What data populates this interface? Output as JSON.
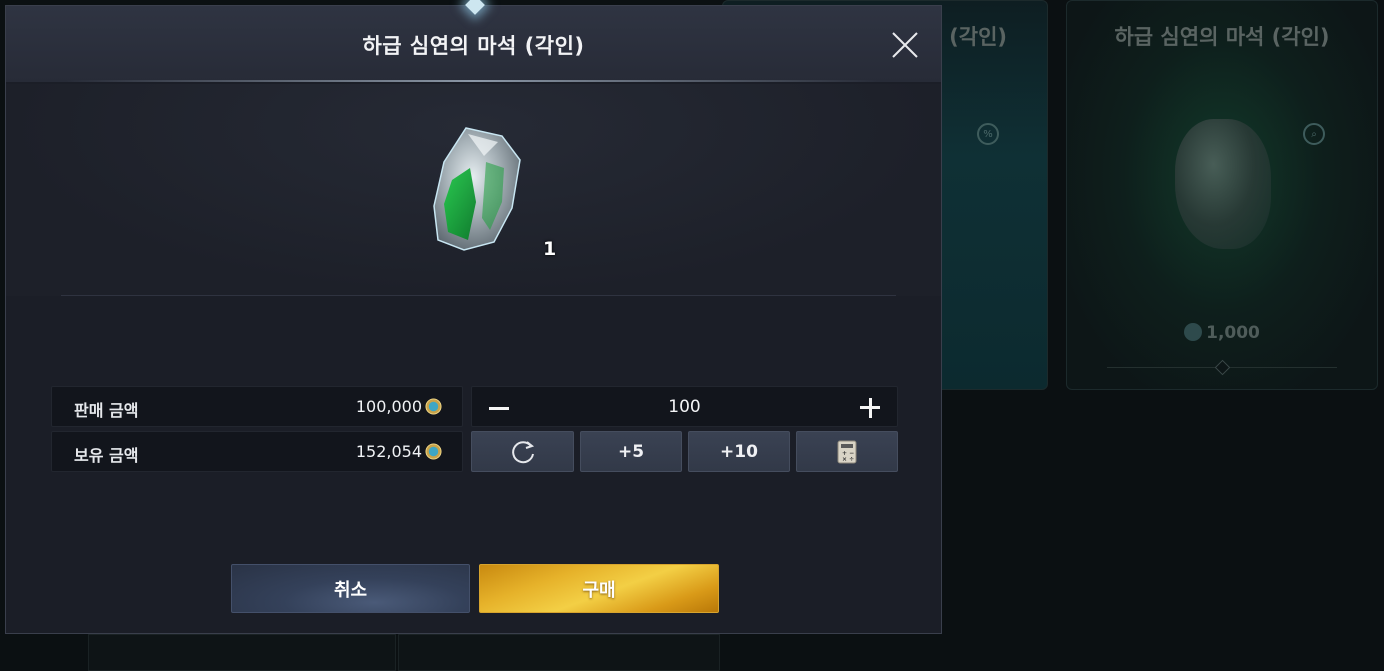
{
  "background": {
    "card_title": "하급 심연의 마석 (각인)",
    "card_title_partial": "(각인)",
    "card_price": "1,000"
  },
  "dialog": {
    "title": "하급 심연의 마석 (각인)",
    "item": {
      "icon": "green-crystal-stone-icon",
      "quantity": "1"
    },
    "sale_price": {
      "label": "판매 금액",
      "value": "100,000",
      "currency_icon": "gold-coin-icon"
    },
    "owned_amount": {
      "label": "보유 금액",
      "value": "152,054",
      "currency_icon": "gold-coin-icon"
    },
    "quantity_stepper": {
      "value": "100"
    },
    "buttons": {
      "reset_icon": "refresh-icon",
      "plus5": "+5",
      "plus10": "+10",
      "calculator_icon": "calculator-icon",
      "cancel": "취소",
      "buy": "구매"
    }
  },
  "colors": {
    "buy_button": "#e6b22a",
    "cancel_button": "#34415a",
    "panel": "#1b1e27"
  }
}
